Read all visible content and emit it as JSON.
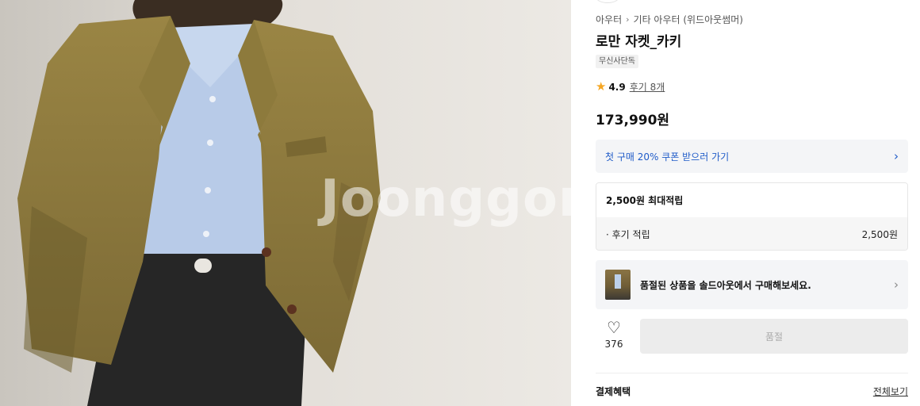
{
  "product_image": {
    "watermark": "Joonggonar"
  },
  "breadcrumb": {
    "items": [
      "아우터",
      "기타 아우터 (위드아웃썸머)"
    ],
    "separator": "›"
  },
  "product": {
    "title": "로만 자켓_카키",
    "badge": "무신사단독",
    "rating": "4.9",
    "review_link": "후기 8개",
    "price": "173,990원"
  },
  "coupon": {
    "label": "첫 구매 20% 쿠폰 받으러 가기",
    "color": "#1f5bc8"
  },
  "points": {
    "title": "2,500원 최대적립",
    "rows": [
      {
        "label": "· 후기 적립",
        "value": "2,500원"
      }
    ]
  },
  "soldout_banner": {
    "text": "품절된 상품을 솔드아웃에서 구매해보세요."
  },
  "actions": {
    "like_icon": "heart-outline-icon",
    "like_count": "376",
    "buy_label": "품절"
  },
  "payment": {
    "title": "결제혜택",
    "more_link": "전체보기"
  },
  "colors": {
    "accent": "#f5a623",
    "jacket": "#8c7a3f",
    "shirt": "#b8cbe8",
    "jeans": "#262626"
  }
}
